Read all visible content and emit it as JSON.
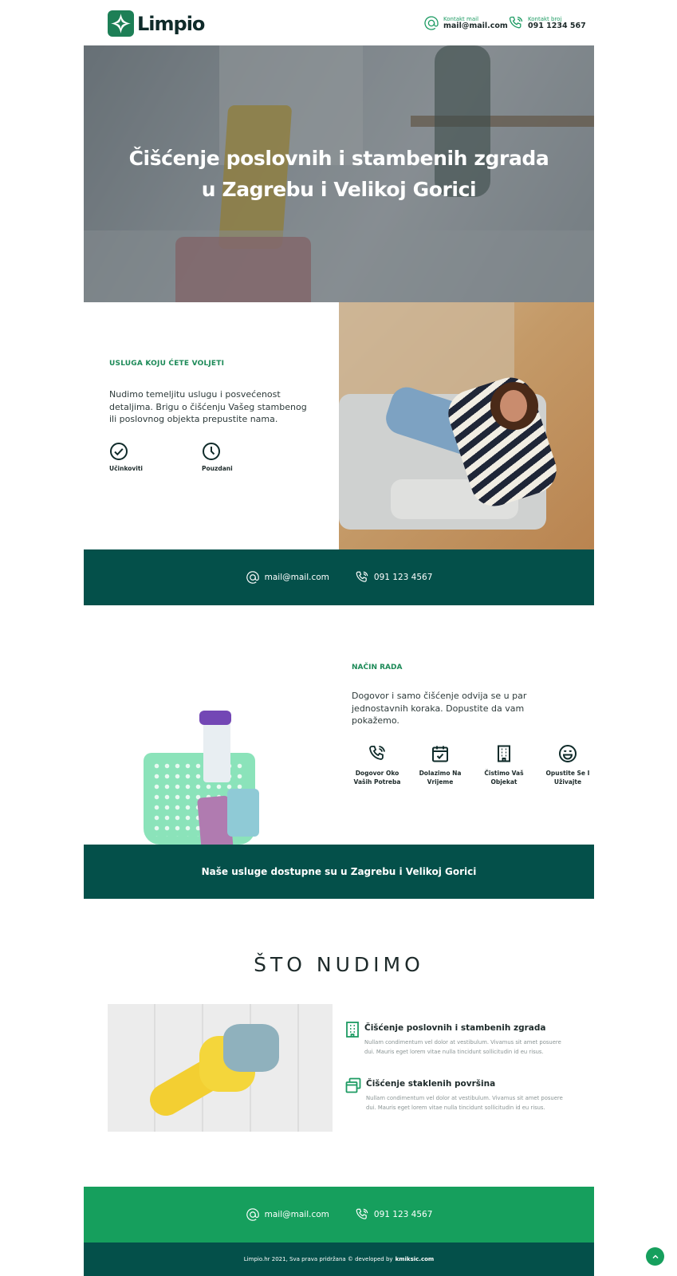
{
  "header": {
    "logo_text": "Limpio",
    "logo_icon": "diamond-star-icon",
    "contacts": [
      {
        "label": "Kontakt mail",
        "value": "mail@mail.com",
        "icon": "at-icon"
      },
      {
        "label": "Kontakt broj",
        "value": "091 1234 567",
        "icon": "phone-ringing-icon"
      }
    ]
  },
  "hero": {
    "title_line1": "Čišćenje poslovnih i stambenih zgrada",
    "title_line2": "u Zagrebu i Velikoj Gorici"
  },
  "service": {
    "eyebrow": "USLUGA KOJU ĆETE VOLJETI",
    "description": "Nudimo temeljitu uslugu i posvećenost detaljima. Brigu o čišćenju Vašeg stambenog ili poslovnog objekta prepustite nama.",
    "features": [
      {
        "label": "Učinkoviti",
        "icon": "check-circle-icon"
      },
      {
        "label": "Pouzdani",
        "icon": "clock-icon"
      }
    ]
  },
  "contact_band": {
    "email": "mail@mail.com",
    "phone": "091 123 4567"
  },
  "method": {
    "eyebrow": "NAČIN RADA",
    "description": "Dogovor i samo čišćenje odvija se u par jednostavnih koraka. Dopustite da vam pokažemo.",
    "steps": [
      {
        "label_line1": "Dogovor Oko",
        "label_line2": "Vaših Potreba",
        "icon": "phone-ringing-icon"
      },
      {
        "label_line1": "Dolazimo Na",
        "label_line2": "Vrijeme",
        "icon": "calendar-check-icon"
      },
      {
        "label_line1": "Čistimo Vaš",
        "label_line2": "Objekat",
        "icon": "building-icon"
      },
      {
        "label_line1": "Opustite Se I",
        "label_line2": "Uživajte",
        "icon": "smile-icon"
      }
    ]
  },
  "banner": {
    "text": "Naše usluge dostupne su u Zagrebu i Velikoj Gorici"
  },
  "offer": {
    "title": "ŠTO NUDIMO",
    "items": [
      {
        "title": "Čišćenje poslovnih i stambenih zgrada",
        "description": "Nullam condimentum vel dolor at vestibulum. Vivamus sit amet posuere dui. Mauris eget lorem vitae nulla tincidunt sollicitudin id eu risus.",
        "icon": "building-icon"
      },
      {
        "title": "Čišćenje staklenih površina",
        "description": "Nullam condimentum vel dolor at vestibulum. Vivamus sit amet posuere dui. Mauris eget lorem vitae nulla tincidunt sollicitudin id eu risus.",
        "icon": "windows-icon"
      }
    ]
  },
  "footer_band": {
    "email": "mail@mail.com",
    "phone": "091 123 4567"
  },
  "footer": {
    "copyright": "Limpio.hr 2021, Sva prava pridržana © developed by",
    "developer": "kmiksic.com"
  },
  "colors": {
    "brand_green": "#1d9b63",
    "dark_green": "#04504a",
    "bright_green": "#169f5d",
    "text_dark": "#1d2a2a"
  }
}
